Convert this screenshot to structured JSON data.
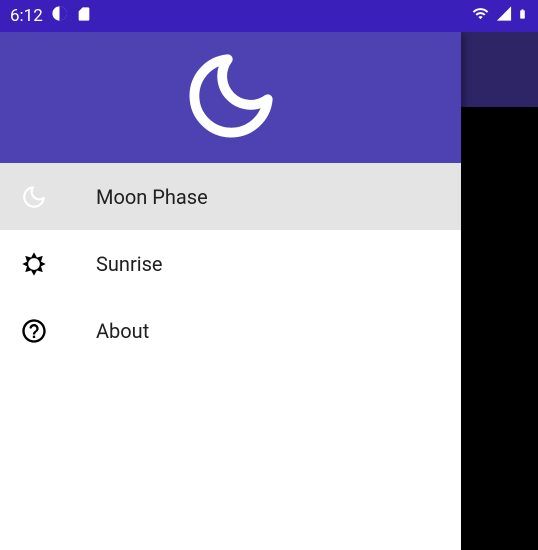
{
  "status": {
    "time": "6:12",
    "icons": {
      "eye": "contrast-icon",
      "sd": "sd-card-icon",
      "wifi": "wifi-icon",
      "signal": "cell-signal-icon",
      "battery": "battery-icon"
    }
  },
  "colors": {
    "statusbar": "#3a1fba",
    "appbar": "#2e2566",
    "drawer_header": "#4e42b3",
    "selected_bg": "#e4e4e4"
  },
  "drawer": {
    "header_icon": "moon-icon",
    "items": [
      {
        "icon": "moon-icon",
        "label": "Moon Phase",
        "selected": true
      },
      {
        "icon": "sun-icon",
        "label": "Sunrise",
        "selected": false
      },
      {
        "icon": "help-icon",
        "label": "About",
        "selected": false
      }
    ]
  }
}
